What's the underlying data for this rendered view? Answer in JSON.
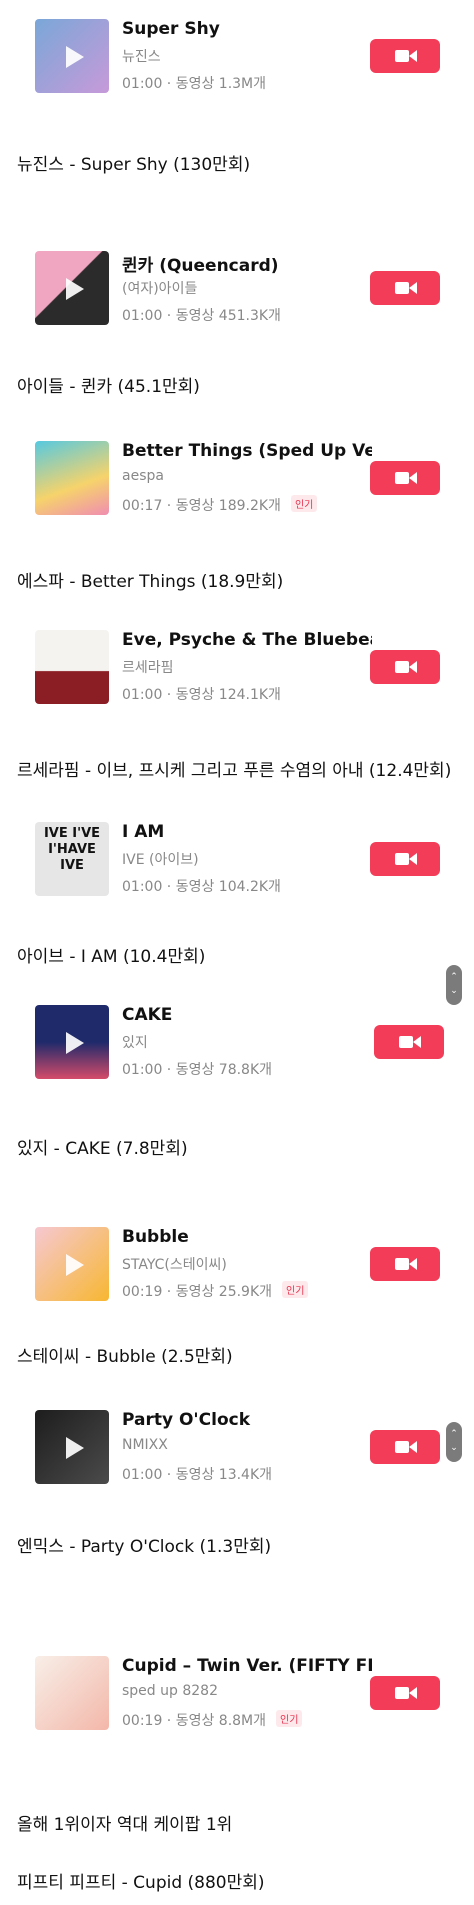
{
  "songs": [
    {
      "title": "Super Shy",
      "artist": "뉴진스",
      "meta": "01:00 · 동영상 1.3M개",
      "badge": "",
      "caption": "뉴진스 - Super Shy (130만회)",
      "thumb_color": "#7aa7d8",
      "thumb_color2": "#c79ad9",
      "play": true
    },
    {
      "title": "퀸카 (Queencard)",
      "artist": "(여자)아이들",
      "meta": "01:00 · 동영상 451.3K개",
      "badge": "",
      "caption": "아이들 - 퀸카 (45.1만회)",
      "thumb_color": "#f0a5c0",
      "thumb_color2": "#2b2b2b",
      "play": true
    },
    {
      "title": "Better Things (Sped Up Ver...",
      "artist": "aespa",
      "meta": "00:17 · 동영상 189.2K개",
      "badge": "인기",
      "caption": "에스파 - Better Things (18.9만회)",
      "thumb_color": "#56c9e0",
      "thumb_color2": "#f6d36b",
      "play": false
    },
    {
      "title": "Eve, Psyche & The Bluebea...",
      "artist": "르세라핌",
      "meta": "01:00 · 동영상 124.1K개",
      "badge": "",
      "caption": "르세라핌 - 이브, 프시케 그리고 푸른 수염의 아내 (12.4만회)",
      "thumb_color": "#f5f3ef",
      "thumb_color2": "#8b1e24",
      "play": false
    },
    {
      "title": "I AM",
      "artist": "IVE (아이브)",
      "meta": "01:00 · 동영상 104.2K개",
      "badge": "",
      "caption": "아이브 - I AM (10.4만회)",
      "thumb_color": "#e6e6e6",
      "thumb_color2": "#bdbdbd",
      "play": false,
      "thumb_text": "IVE I'VE I'HAVE IVE"
    },
    {
      "title": "CAKE",
      "artist": "있지",
      "meta": "01:00 · 동영상 78.8K개",
      "badge": "",
      "caption": "있지 - CAKE (7.8만회)",
      "thumb_color": "#1f2a6b",
      "thumb_color2": "#d44b6a",
      "play": true
    },
    {
      "title": "Bubble",
      "artist": "STAYC(스테이씨)",
      "meta": "00:19 · 동영상 25.9K개",
      "badge": "인기",
      "caption": "스테이씨 - Bubble (2.5만회)",
      "thumb_color": "#f6c8d2",
      "thumb_color2": "#f7b731",
      "play": true
    },
    {
      "title": "Party O'Clock",
      "artist": "NMIXX",
      "meta": "01:00 · 동영상 13.4K개",
      "badge": "",
      "caption": "엔믹스 - Party O'Clock (1.3만회)",
      "thumb_color": "#1d1d1d",
      "thumb_color2": "#4b4b4b",
      "play": true
    },
    {
      "title": "Cupid – Twin Ver. (FIFTY FI...",
      "artist": "sped up 8282",
      "meta": "00:19 · 동영상 8.8M개",
      "badge": "인기",
      "caption": "",
      "thumb_color": "#f8efe8",
      "thumb_color2": "#f3b7a9",
      "play": false
    }
  ],
  "extra_captions": [
    "올해 1위이자 역대 케이팝 1위",
    "피프티 피프티 - Cupid (880만회)"
  ],
  "colors": {
    "accent": "#f23c58",
    "muted": "#888888"
  }
}
